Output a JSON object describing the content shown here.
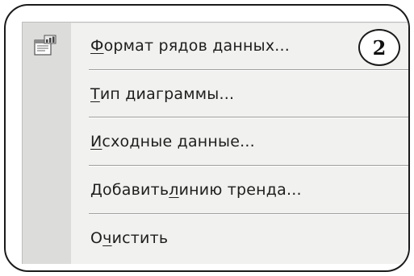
{
  "menu": {
    "icon": "format-data-series-icon",
    "items": [
      {
        "accel": "Ф",
        "rest": "ормат рядов данных...",
        "before": ""
      },
      {
        "accel": "Т",
        "rest": "ип диаграммы...",
        "before": ""
      },
      {
        "accel": "И",
        "rest": "сходные данные...",
        "before": ""
      },
      {
        "before": "Добавить ",
        "accel": "л",
        "rest": "инию тренда..."
      },
      {
        "before": "О",
        "accel": "ч",
        "rest": "истить"
      }
    ]
  },
  "callout": {
    "number": "2"
  }
}
